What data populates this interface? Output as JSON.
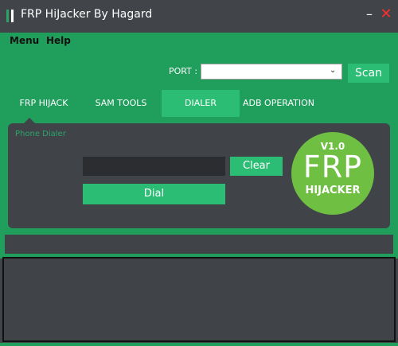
{
  "window": {
    "title": "FRP HiJacker By Hagard",
    "minimize_symbol": "–",
    "close_symbol": "✕"
  },
  "menu": {
    "items": [
      {
        "label": "Menu"
      },
      {
        "label": "Help"
      }
    ]
  },
  "port": {
    "label": "PORT :",
    "selected_value": "",
    "dropdown_arrow": "⌄",
    "scan_label": "Scan"
  },
  "tabs": [
    {
      "label": "FRP HIJACK",
      "active": false
    },
    {
      "label": "SAM TOOLS",
      "active": false
    },
    {
      "label": "DIALER",
      "active": true
    },
    {
      "label": "ADB OPERATION",
      "active": false
    }
  ],
  "dialer": {
    "section_label": "Phone Dialer",
    "number_value": "",
    "clear_label": "Clear",
    "dial_label": "Dial"
  },
  "logo": {
    "version": "V1.0",
    "main": "FRP",
    "sub": "HIJACKER"
  },
  "colors": {
    "accent": "#1f9e5c",
    "button": "#2bbd74",
    "panel": "#404448",
    "logo": "#6fbf43",
    "close": "#ff2d2d"
  },
  "icons": {
    "app": "app-logo-icon",
    "minimize": "minimize-icon",
    "close": "close-icon",
    "dropdown": "chevron-down-icon"
  }
}
